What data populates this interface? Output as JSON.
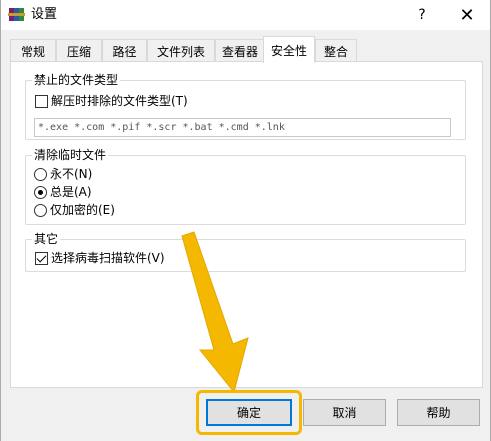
{
  "window": {
    "title": "设置",
    "help_glyph": "?",
    "close_glyph": "✕",
    "icon": "winrar-books-icon"
  },
  "tabs": [
    {
      "label": "常规"
    },
    {
      "label": "压缩"
    },
    {
      "label": "路径"
    },
    {
      "label": "文件列表"
    },
    {
      "label": "查看器"
    },
    {
      "label": "安全性",
      "active": true
    },
    {
      "label": "整合"
    }
  ],
  "forbidden": {
    "title": "禁止的文件类型",
    "checkbox_label": "解压时排除的文件类型(T)",
    "checked": false,
    "types_value": "*.exe *.com *.pif *.scr *.bat *.cmd *.lnk"
  },
  "temp": {
    "title": "清除临时文件",
    "options": [
      {
        "label": "永不(N)",
        "selected": false
      },
      {
        "label": "总是(A)",
        "selected": true
      },
      {
        "label": "仅加密的(E)",
        "selected": false
      }
    ]
  },
  "other": {
    "title": "其它",
    "checkbox_label": "选择病毒扫描软件(V)",
    "checked": true
  },
  "buttons": {
    "ok": "确定",
    "cancel": "取消",
    "help": "帮助"
  },
  "annotation": {
    "arrow_color": "#f5b800",
    "arrow_icon": "pointer-arrow-icon"
  }
}
